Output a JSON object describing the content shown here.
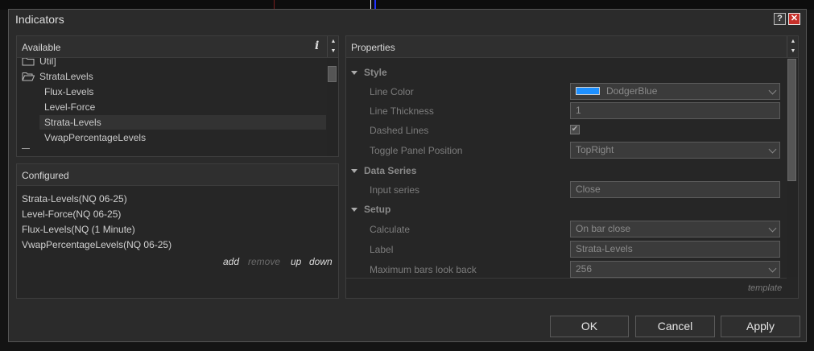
{
  "window": {
    "title": "Indicators",
    "help_glyph": "?",
    "close_glyph": "✕"
  },
  "available": {
    "header": "Available",
    "info_glyph": "i",
    "items": [
      {
        "label": "Util]",
        "kind": "folder"
      },
      {
        "label": "StrataLevels",
        "kind": "folder"
      },
      {
        "label": "Flux-Levels",
        "kind": "item"
      },
      {
        "label": "Level-Force",
        "kind": "item"
      },
      {
        "label": "Strata-Levels",
        "kind": "item",
        "selected": true
      },
      {
        "label": "VwapPercentageLevels",
        "kind": "item"
      }
    ]
  },
  "configured": {
    "header": "Configured",
    "items": [
      "Strata-Levels(NQ 06-25)",
      "Level-Force(NQ 06-25)",
      "Flux-Levels(NQ (1 Minute)",
      "VwapPercentageLevels(NQ 06-25)"
    ],
    "actions": {
      "add": "add",
      "remove": "remove",
      "up": "up",
      "down": "down"
    }
  },
  "properties": {
    "header": "Properties",
    "sections": {
      "style": "Style",
      "data_series": "Data Series",
      "setup": "Setup"
    },
    "line_color": {
      "label": "Line Color",
      "value": "DodgerBlue",
      "swatch": "#1e90ff"
    },
    "line_thickness": {
      "label": "Line Thickness",
      "value": "1"
    },
    "dashed_lines": {
      "label": "Dashed Lines",
      "checked": true,
      "check_glyph": "✔"
    },
    "toggle_panel_position": {
      "label": "Toggle Panel Position",
      "value": "TopRight"
    },
    "input_series": {
      "label": "Input series",
      "value": "Close"
    },
    "calculate": {
      "label": "Calculate",
      "value": "On bar close"
    },
    "label": {
      "label": "Label",
      "value": "Strata-Levels"
    },
    "max_bars": {
      "label": "Maximum bars look back",
      "value": "256"
    },
    "template_link": "template"
  },
  "buttons": {
    "ok": "OK",
    "cancel": "Cancel",
    "apply": "Apply"
  },
  "colors": {
    "accent_red": "#c8302a",
    "swatch_blue": "#1e90ff",
    "chart_blue_line": "#2233ff",
    "chart_red_marker": "#cc2222"
  }
}
